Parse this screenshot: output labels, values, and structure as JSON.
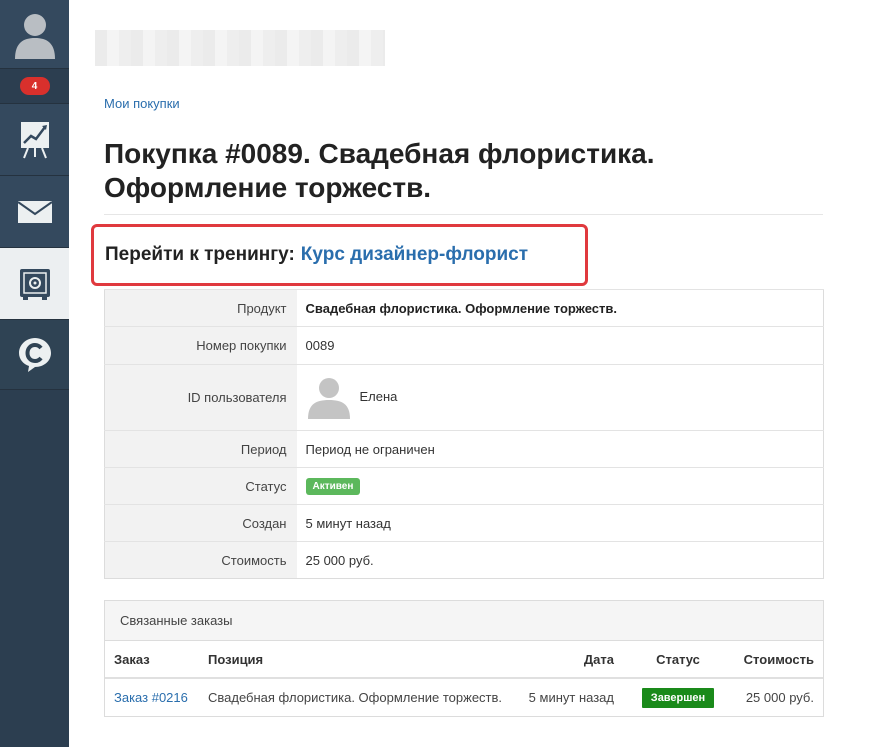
{
  "sidebar": {
    "notification_count": "4"
  },
  "breadcrumb": "Мои покупки",
  "title": "Покупка #0089. Свадебная флористика. Оформление торжеств.",
  "goto": {
    "label": "Перейти к тренингу:",
    "link": "Курс дизайнер-флорист"
  },
  "info": {
    "product_label": "Продукт",
    "product_value": "Свадебная флористика. Оформление торжеств.",
    "number_label": "Номер покупки",
    "number_value": "0089",
    "user_label": "ID пользователя",
    "user_name": "Елена",
    "period_label": "Период",
    "period_value": "Период не ограничен",
    "status_label": "Статус",
    "status_value": "Активен",
    "created_label": "Создан",
    "created_value": "5 минут назад",
    "cost_label": "Стоимость",
    "cost_value": "25 000 руб."
  },
  "related": {
    "heading": "Связанные заказы",
    "columns": [
      "Заказ",
      "Позиция",
      "Дата",
      "Статус",
      "Стоимость"
    ],
    "rows": [
      {
        "order": "Заказ #0216",
        "position": "Свадебная флористика. Оформление торжеств.",
        "date": "5 минут назад",
        "status": "Завершен",
        "cost": "25 000 руб."
      }
    ]
  },
  "colors": {
    "sidebar_bg": "#2c3e50",
    "link": "#2a6ead",
    "highlight_border": "#e0393e",
    "status_active": "#5cb85c",
    "status_done": "#1a8a1a",
    "badge": "#d9302c"
  }
}
